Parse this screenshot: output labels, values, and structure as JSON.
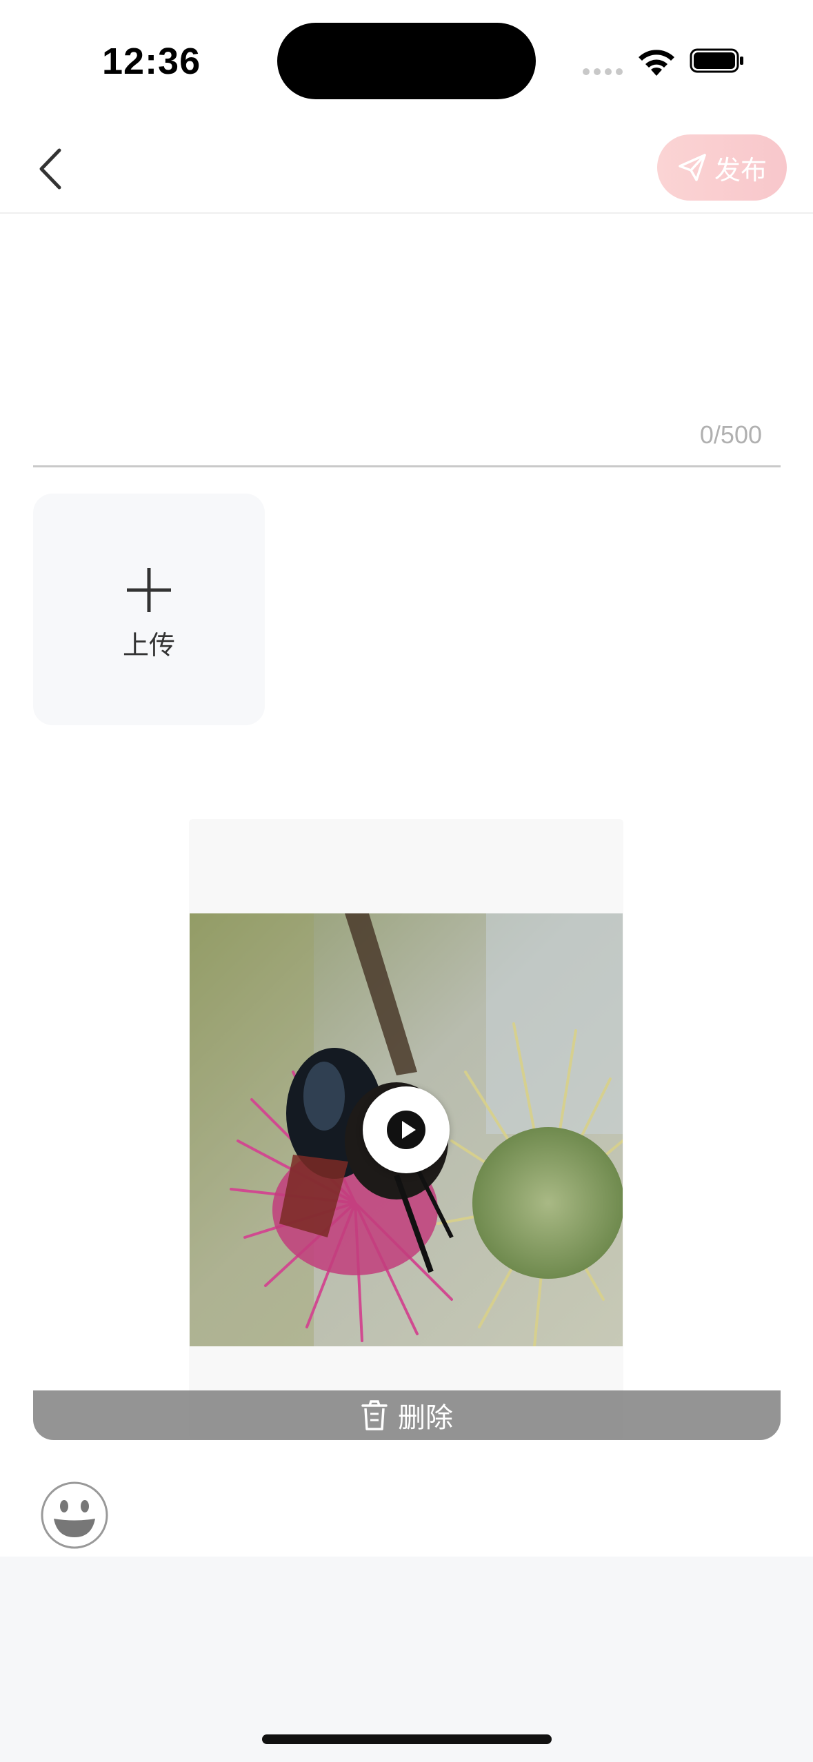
{
  "status_bar": {
    "time": "12:36"
  },
  "header": {
    "publish_label": "发布"
  },
  "editor": {
    "char_count": "0/500"
  },
  "upload": {
    "label": "上传"
  },
  "video": {
    "delete_label": "删除"
  },
  "colors": {
    "publish_gradient_start": "#fbd4d4",
    "publish_gradient_end": "#f8c7cb",
    "delete_bar": "#828282",
    "upload_tile_bg": "#f7f8fa"
  }
}
